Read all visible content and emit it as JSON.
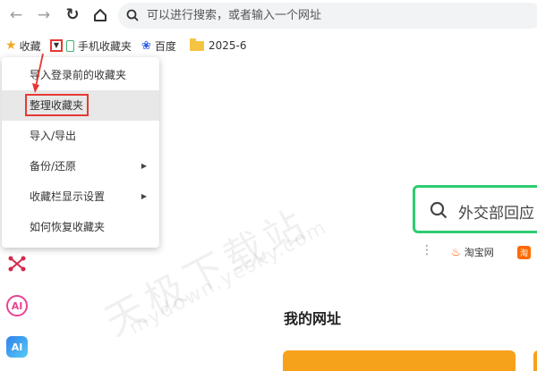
{
  "toolbar": {
    "back_icon": "back-arrow-icon",
    "forward_icon": "forward-arrow-icon",
    "reload_icon": "reload-icon",
    "home_icon": "home-icon",
    "address_placeholder": "可以进行搜索，或者输入一个网址"
  },
  "bookmarks_bar": {
    "favorites_label": "收藏",
    "items": [
      {
        "label": "手机收藏夹",
        "icon": "phone-icon"
      },
      {
        "label": "百度",
        "icon": "baidu-paw-icon"
      },
      {
        "label": "2025-6",
        "icon": "folder-icon"
      }
    ]
  },
  "dropdown_menu": {
    "items": [
      {
        "label": "导入登录前的收藏夹",
        "has_submenu": false
      },
      {
        "label": "整理收藏夹",
        "has_submenu": false,
        "highlighted": true
      },
      {
        "label": "导入/导出",
        "has_submenu": false
      },
      {
        "label": "备份/还原",
        "has_submenu": true
      },
      {
        "label": "收藏栏显示设置",
        "has_submenu": true
      },
      {
        "label": "如何恢复收藏夹",
        "has_submenu": false
      }
    ]
  },
  "main": {
    "search_text": "外交部回应",
    "quick_links": [
      {
        "label": "淘宝网",
        "icon": "taobao-flame-icon"
      },
      {
        "label": "淘",
        "icon": "tmall-icon"
      }
    ],
    "section_title": "我的网址"
  },
  "sidebar_icons": [
    {
      "name": "network-icon"
    },
    {
      "name": "ai-assistant-icon",
      "text": "AI"
    },
    {
      "name": "ai-app-icon",
      "text": "AI"
    }
  ],
  "watermark": {
    "line1": "天极下载站",
    "line2": "mydown.yesky.com"
  },
  "colors": {
    "accent_green": "#2ecc71",
    "highlight_red": "#e53935",
    "star_orange": "#f5a623",
    "card_orange": "#f7a21b"
  }
}
